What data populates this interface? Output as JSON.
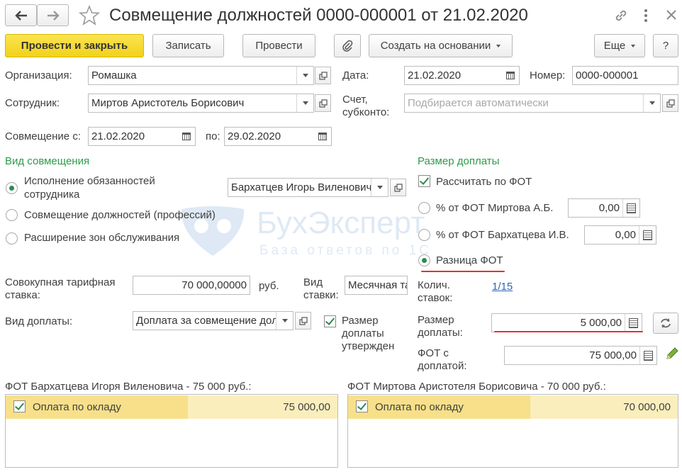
{
  "header": {
    "title": "Совмещение должностей 0000-000001 от 21.02.2020"
  },
  "toolbar": {
    "post_close": "Провести и закрыть",
    "save": "Записать",
    "post": "Провести",
    "create_based": "Создать на основании",
    "more": "Еще",
    "help": "?"
  },
  "form": {
    "org_label": "Организация:",
    "org_value": "Ромашка",
    "date_label": "Дата:",
    "date_value": "21.02.2020",
    "number_label": "Номер:",
    "number_value": "0000-000001",
    "employee_label": "Сотрудник:",
    "employee_value": "Миртов Аристотель Борисович",
    "account_label_1": "Счет,",
    "account_label_2": "субконто:",
    "account_placeholder": "Подбирается автоматически",
    "from_label": "Совмещение с:",
    "from_value": "21.02.2020",
    "to_label": "по:",
    "to_value": "29.02.2020"
  },
  "combo_type": {
    "heading": "Вид совмещения",
    "options": [
      {
        "label_1": "Исполнение обязанностей",
        "label_2": "сотрудника",
        "selected": true
      },
      {
        "label_1": "Совмещение должностей (профессий)",
        "selected": false
      },
      {
        "label_1": "Расширение зон обслуживания",
        "selected": false
      }
    ],
    "substitute_value": "Бархатцев Игорь Виленович"
  },
  "surcharge": {
    "heading": "Размер доплаты",
    "calc_by_fot_label": "Рассчитать по ФОТ",
    "calc_by_fot_checked": true,
    "options": [
      {
        "label": "% от ФОТ Миртова А.Б.",
        "value": "0,00",
        "selected": false
      },
      {
        "label": "% от ФОТ Бархатцева И.В.",
        "value": "0,00",
        "selected": false
      },
      {
        "label": "Разница ФОТ",
        "selected": true
      }
    ],
    "rate_count_label_1": "Колич.",
    "rate_count_label_2": "ставок:",
    "rate_count_value": "1/15",
    "amount_label_1": "Размер",
    "amount_label_2": "доплаты:",
    "amount_value": "5 000,00",
    "fot_with_label_1": "ФОТ с",
    "fot_with_label_2": "доплатой:",
    "fot_with_value": "75 000,00"
  },
  "tariff": {
    "label_1": "Совокупная тарифная",
    "label_2": "ставка:",
    "value": "70 000,00000",
    "currency": "руб.",
    "rate_kind_label_1": "Вид",
    "rate_kind_label_2": "ставки:",
    "rate_kind_value": "Месячная тарифная ставка"
  },
  "payment_kind": {
    "label": "Вид доплаты:",
    "value": "Доплата за совмещение должностей",
    "approved_label_1": "Размер",
    "approved_label_2": "доплаты",
    "approved_label_3": "утвержден",
    "approved_checked": true
  },
  "fot_tables": [
    {
      "title": "ФОТ Бархатцева Игоря Виленовича - 75 000 руб.:",
      "row_label": "Оплата по окладу",
      "row_value": "75 000,00",
      "checked": true
    },
    {
      "title": "ФОТ Миртова Аристотеля Борисовича - 70 000 руб.:",
      "row_label": "Оплата по окладу",
      "row_value": "70 000,00",
      "checked": true
    }
  ],
  "watermark": {
    "brand": "БухЭксперт",
    "tagline": "База ответов по 1С"
  }
}
